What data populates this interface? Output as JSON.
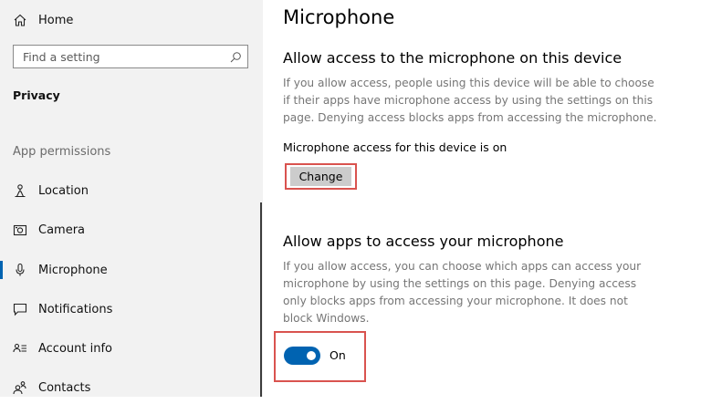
{
  "sidebar": {
    "home_label": "Home",
    "search_placeholder": "Find a setting",
    "category": "Privacy",
    "section_header": "App permissions",
    "items": [
      {
        "label": "Location",
        "icon": "location-icon",
        "active": false
      },
      {
        "label": "Camera",
        "icon": "camera-icon",
        "active": false
      },
      {
        "label": "Microphone",
        "icon": "microphone-icon",
        "active": true
      },
      {
        "label": "Notifications",
        "icon": "notifications-icon",
        "active": false
      },
      {
        "label": "Account info",
        "icon": "account-info-icon",
        "active": false
      },
      {
        "label": "Contacts",
        "icon": "contacts-icon",
        "active": false
      }
    ]
  },
  "main": {
    "title": "Microphone",
    "device_section": {
      "heading": "Allow access to the microphone on this device",
      "description": "If you allow access, people using this device will be able to choose if their apps have microphone access by using the settings on this page. Denying access blocks apps from accessing the microphone.",
      "status": "Microphone access for this device is on",
      "button_label": "Change"
    },
    "apps_section": {
      "heading": "Allow apps to access your microphone",
      "description": "If you allow access, you can choose which apps can access your microphone by using the settings on this page. Denying access only blocks apps from accessing your microphone. It does not block Windows.",
      "toggle_state": "On"
    }
  },
  "colors": {
    "accent": "#0063b1",
    "highlight": "#d9534f",
    "sidebar_bg": "#f2f2f2",
    "muted_text": "#767676"
  }
}
